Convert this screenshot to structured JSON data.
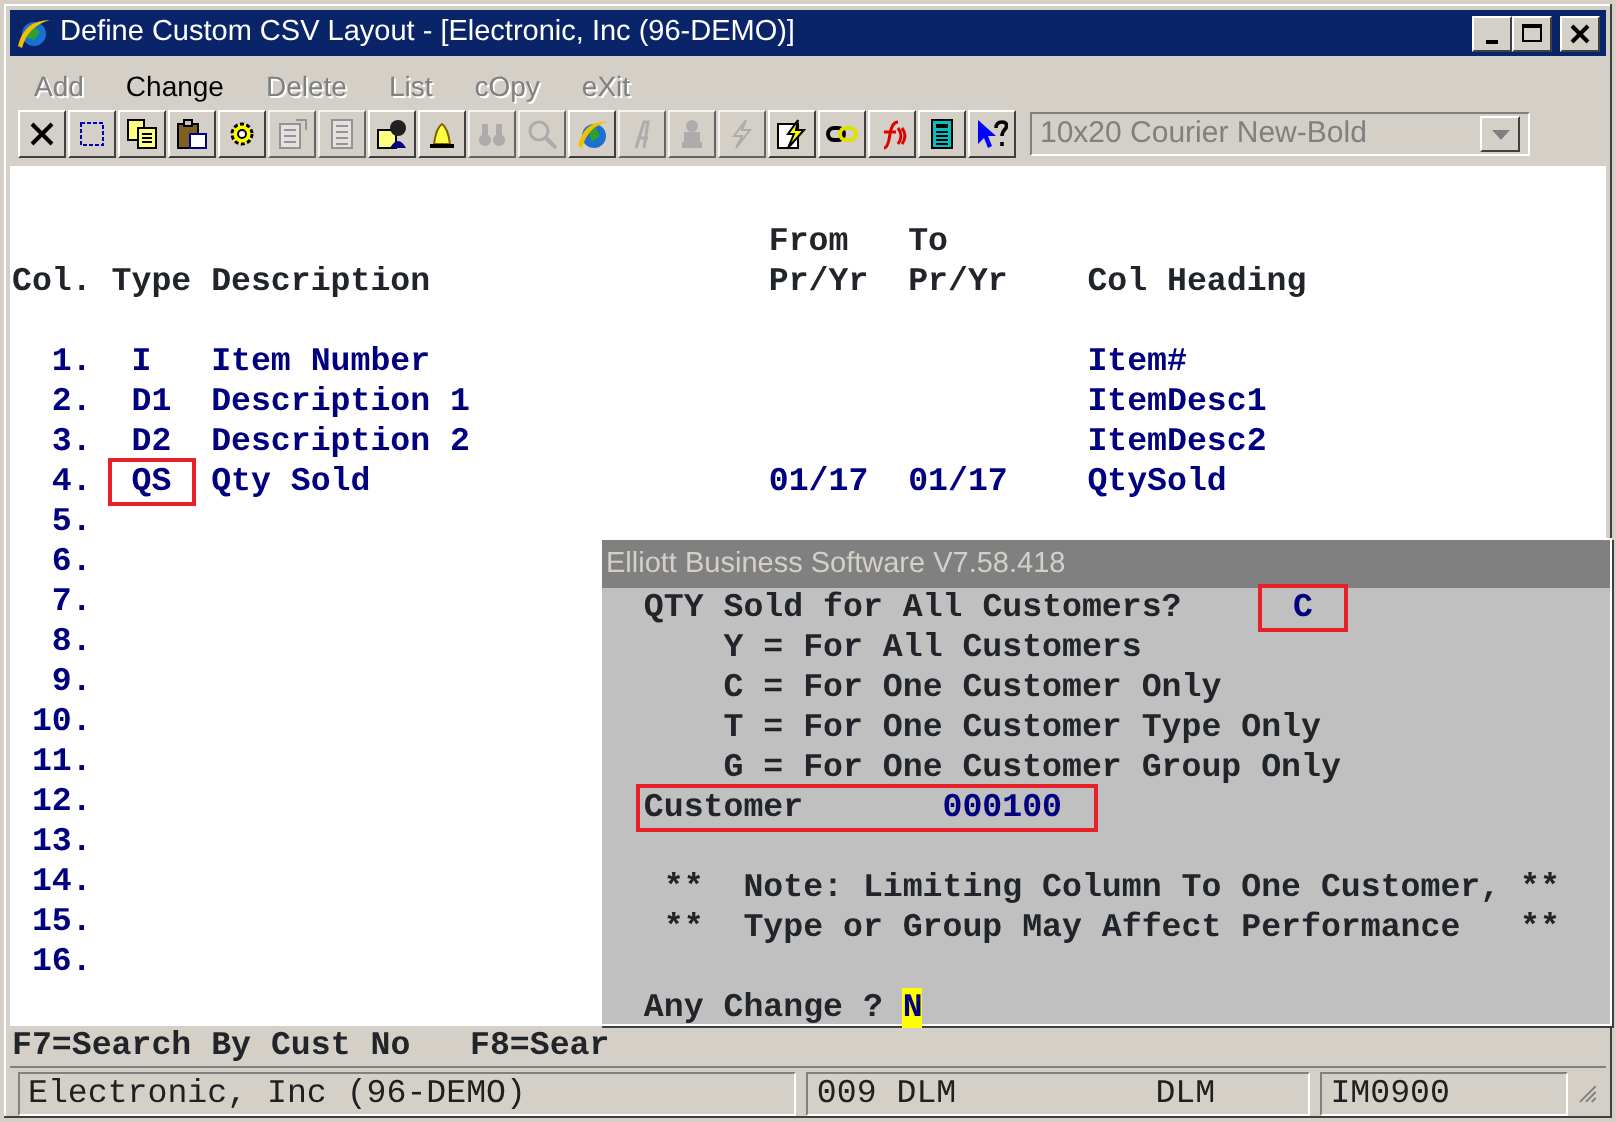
{
  "window": {
    "title": "Define Custom CSV Layout - [Electronic, Inc (96-DEMO)]"
  },
  "menu": [
    {
      "label": "Add",
      "disabled": true
    },
    {
      "label": "Change",
      "disabled": false
    },
    {
      "label": "Delete",
      "disabled": true
    },
    {
      "label": "List",
      "disabled": true
    },
    {
      "label": "cOpy",
      "disabled": true
    },
    {
      "label": "eXit",
      "disabled": true
    }
  ],
  "toolbar": [
    {
      "kind": "close",
      "disabled": false
    },
    {
      "kind": "select",
      "disabled": false
    },
    {
      "kind": "copy",
      "disabled": false
    },
    {
      "kind": "paste",
      "disabled": false
    },
    {
      "kind": "gear",
      "disabled": false
    },
    {
      "kind": "properties",
      "disabled": true
    },
    {
      "kind": "list",
      "disabled": true
    },
    {
      "kind": "person",
      "disabled": false
    },
    {
      "kind": "bell",
      "disabled": false
    },
    {
      "kind": "binoculars",
      "disabled": true
    },
    {
      "kind": "magnifier",
      "disabled": true
    },
    {
      "kind": "globe",
      "disabled": false
    },
    {
      "kind": "letter",
      "disabled": true
    },
    {
      "kind": "figure",
      "disabled": true
    },
    {
      "kind": "lightning",
      "disabled": true
    },
    {
      "kind": "doclightning",
      "disabled": false
    },
    {
      "kind": "link",
      "disabled": false
    },
    {
      "kind": "function",
      "disabled": false
    },
    {
      "kind": "calculator",
      "disabled": false
    },
    {
      "kind": "help",
      "disabled": false
    }
  ],
  "font_combo": {
    "value": "10x20 Courier New-Bold",
    "disabled": true
  },
  "table": {
    "columns": [
      {
        "bottom": "Col."
      },
      {
        "bottom": "Type"
      },
      {
        "bottom": "Description"
      },
      {
        "top": "From",
        "bottom": "Pr/Yr"
      },
      {
        "top": "To",
        "bottom": "Pr/Yr"
      },
      {
        "bottom": "Col Heading"
      }
    ],
    "rows": [
      {
        "number": "1.",
        "type": "I",
        "description": "Item Number",
        "heading": "Item#",
        "highlighted": false
      },
      {
        "number": "2.",
        "type": "D1",
        "description": "Description 1",
        "heading": "ItemDesc1",
        "highlighted": false
      },
      {
        "number": "3.",
        "type": "D2",
        "description": "Description 2",
        "heading": "ItemDesc2",
        "highlighted": false
      },
      {
        "number": "4.",
        "type": "QS",
        "description": "Qty Sold",
        "from": "01/17",
        "to": "01/17",
        "heading": "QtySold",
        "highlighted": true
      },
      {
        "number": "5."
      },
      {
        "number": "6."
      },
      {
        "number": "7."
      },
      {
        "number": "8."
      },
      {
        "number": "9."
      },
      {
        "number": "10."
      },
      {
        "number": "11."
      },
      {
        "number": "12."
      },
      {
        "number": "13."
      },
      {
        "number": "14."
      },
      {
        "number": "15."
      },
      {
        "number": "16."
      }
    ]
  },
  "dialog": {
    "title": "Elliott Business Software V7.58.418",
    "prompt": "QTY Sold for All Customers?",
    "answer": "C",
    "answer_highlighted": true,
    "options": [
      "Y = For All Customers",
      "C = For One Customer Only",
      "T = For One Customer Type Only",
      "G = For One Customer Group Only"
    ],
    "customer_label": "Customer",
    "customer_value": "000100",
    "customer_highlighted": true,
    "notes": [
      "**  Note: Limiting Column To One Customer, **",
      "**  Type or Group May Affect Performance   **"
    ],
    "change_prompt": "Any Change ?",
    "change_value": "N"
  },
  "function_keys": [
    "F7=Search By Cust No",
    "F8=Sear"
  ],
  "status_bar": {
    "company": "Electronic, Inc (96-DEMO)",
    "user": "009 DLM",
    "user_2": "DLM",
    "program": "IM0900"
  }
}
